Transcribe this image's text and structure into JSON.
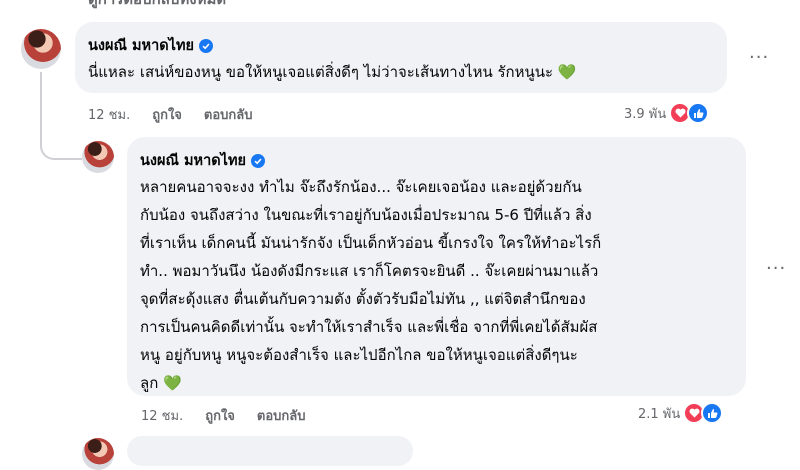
{
  "top_cut_text": "ดูการตอบกลับทั้งหมด",
  "comments": [
    {
      "author": "นงผณี มหาดไทย",
      "text_lines": [
        "นี่แหละ เสน่ห์ของหนู ขอให้หนูเจอแต่สิ่งดีๆ ไม่ว่าจะเส้นทางไหน รักหนูนะ 💚"
      ],
      "time": "12 ชม.",
      "like_label": "ถูกใจ",
      "reply_label": "ตอบกลับ",
      "reaction_count": "3.9 พัน"
    },
    {
      "author": "นงผณี มหาดไทย",
      "text_lines": [
        "หลายคนอาจจะงง ทำไม จ๊ะถึงรักน้อง... จ๊ะเคยเจอน้อง และอยู่ด้วยกัน",
        "กับน้อง จนถึงสว่าง ในขณะที่เราอยู่กับน้องเมื่อประมาณ 5-6 ปีที่แล้ว สิ่ง",
        "ที่เราเห็น เด็กคนนี้ มันน่ารักจัง เป็นเด็กหัวอ่อน ขี้เกรงใจ ใครให้ทำอะไรก็",
        "ทำ.. พอมาวันนึง น้องดังมีกระแส เราก็โคตรจะยินดี .. จ๊ะเคยผ่านมาแล้ว",
        "จุดที่สะดุ้งแสง ตื่นเต้นกับความดัง ตั้งตัวรับมือไม่ทัน ,, แต่จิตสำนึกของ",
        "การเป็นคนคิดดีเท่านั้น จะทำให้เราสำเร็จ และพี่เชื่อ จากที่พี่เคยได้สัมผัส",
        "หนู อยู่กับหนู หนูจะต้องสำเร็จ และไปอีกไกล ขอให้หนูเจอแต่สิ่งดีๆนะ",
        "ลูก 💚"
      ],
      "time": "12 ชม.",
      "like_label": "ถูกใจ",
      "reply_label": "ตอบกลับ",
      "reaction_count": "2.1 พัน"
    }
  ],
  "icons": {
    "verified": "verified-badge-icon",
    "love": "love-reaction-icon",
    "like": "like-reaction-icon",
    "more": "more-options-icon"
  },
  "colors": {
    "bubble": "#f0f2f5",
    "secondary_text": "#65676b",
    "verified": "#1877f2",
    "love": "#f33e58",
    "like": "#1877f2"
  }
}
